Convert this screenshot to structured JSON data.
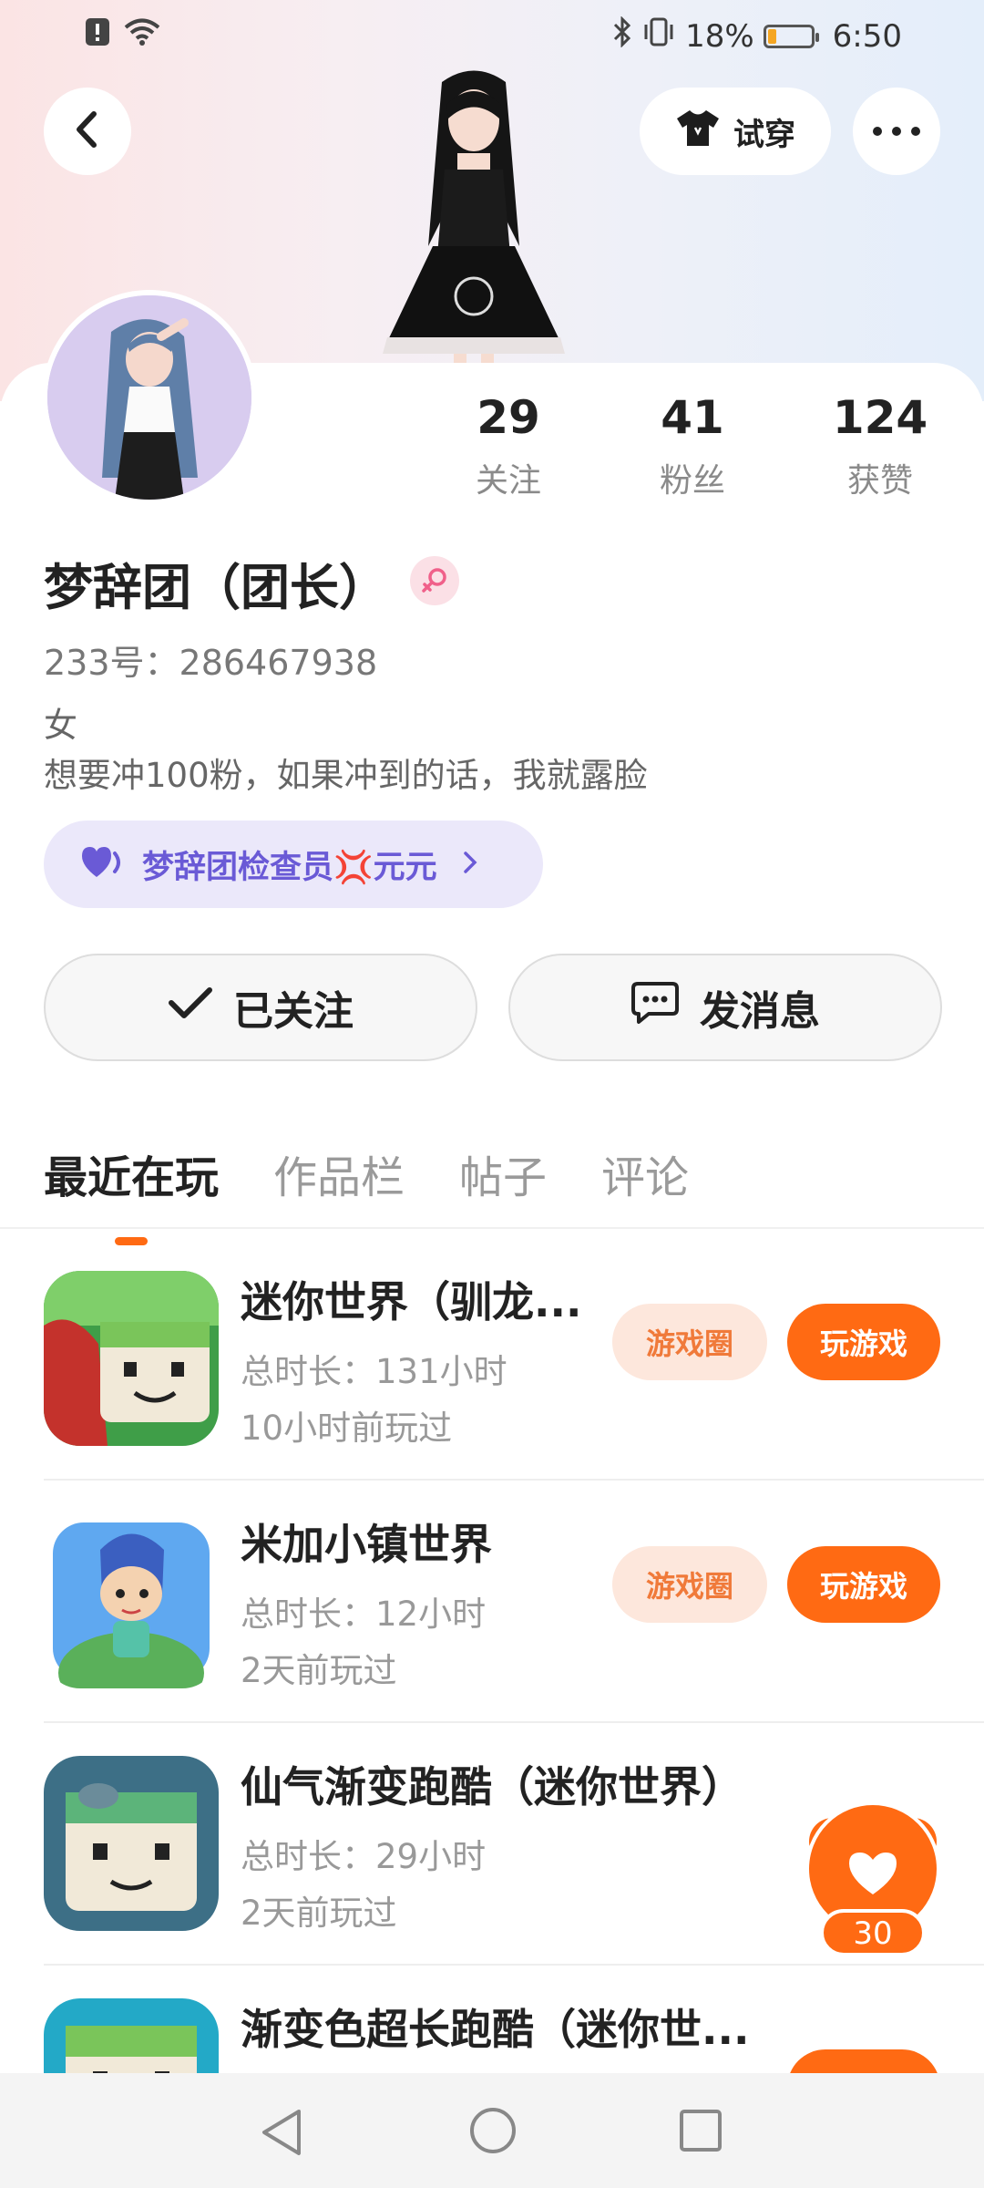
{
  "status_bar": {
    "battery": "18%",
    "time": "6:50",
    "battery_level": 0.18
  },
  "header": {
    "try_on_label": "试穿"
  },
  "profile": {
    "following": {
      "count": "29",
      "label": "关注"
    },
    "followers": {
      "count": "41",
      "label": "粉丝"
    },
    "likes": {
      "count": "124",
      "label": "获赞"
    },
    "name": "梦辞团（团长）",
    "uid": "233号：286467938",
    "bio_line1": "女",
    "bio_line2": "想要冲100粉，如果冲到的话，我就露脸",
    "club_label": "梦辞团检查员💢元元"
  },
  "actions": {
    "follow_label": "已关注",
    "message_label": "发消息"
  },
  "tabs": [
    "最近在玩",
    "作品栏",
    "帖子",
    "评论"
  ],
  "games": [
    {
      "title": "迷你世界（驯龙...",
      "duration": "总时长：131小时",
      "last_played": "10小时前玩过",
      "circle_label": "游戏圈",
      "play_label": "玩游戏"
    },
    {
      "title": "米加小镇世界",
      "duration": "总时长：12小时",
      "last_played": "2天前玩过",
      "circle_label": "游戏圈",
      "play_label": "玩游戏"
    },
    {
      "title": "仙气渐变跑酷（迷你世界）",
      "duration": "总时长：29小时",
      "last_played": "2天前玩过"
    },
    {
      "title": "渐变色超长跑酷（迷你世..."
    }
  ],
  "floating_like": {
    "count": "30"
  },
  "colors": {
    "accent": "#ff6a13",
    "club_text": "#6a5ad6"
  }
}
